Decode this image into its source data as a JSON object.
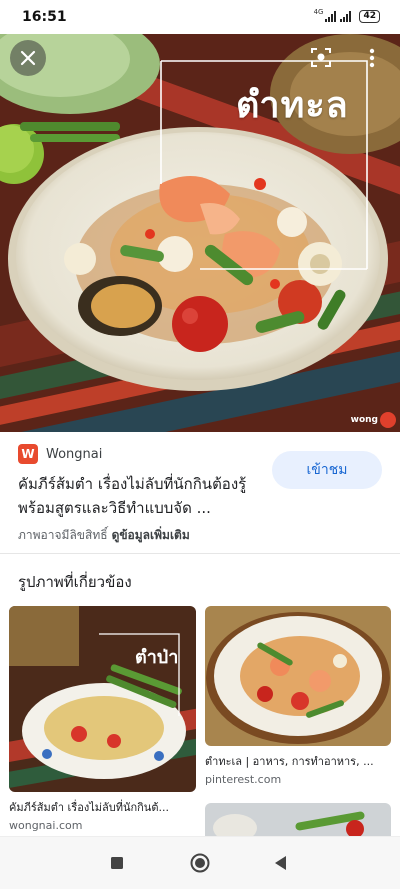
{
  "status_bar": {
    "time": "16:51",
    "network_label": "4G",
    "battery": "42"
  },
  "hero": {
    "image_title_text": "ตำทะล",
    "watermark": "wong",
    "icons": [
      "close-icon",
      "lens-icon",
      "more-vert-icon"
    ]
  },
  "source": {
    "favicon_letter": "W",
    "site_name": "Wongnai",
    "title": "คัมภีร์ส้มตำ เรื่องไม่ลับที่นักกินต้องรู้ พร้อมสูตรและวิธีทำแบบจัด ...",
    "visit_label": "เข้าชม",
    "copyright_text": "ภาพอาจมีลิขสิทธิ์",
    "more_link": "ดูข้อมูลเพิ่มเติม"
  },
  "related": {
    "heading": "รูปภาพที่เกี่ยวข้อง",
    "items": [
      {
        "caption": "คัมภีร์ส้มตำ เรื่องไม่ลับที่นักกินต้...",
        "domain": "wongnai.com",
        "thumb_text": "ตำป่า"
      },
      {
        "caption": "ตำทะเล | อาหาร, การทำอาหาร, ...",
        "domain": "pinterest.com"
      },
      {
        "caption": "",
        "domain": ""
      }
    ]
  },
  "colors": {
    "accent": "#1967d2",
    "button_bg": "#e8f0fe",
    "favicon": "#e84a2e"
  },
  "nav": {
    "icons": [
      "recents-square-icon",
      "home-circle-icon",
      "back-triangle-icon"
    ]
  }
}
